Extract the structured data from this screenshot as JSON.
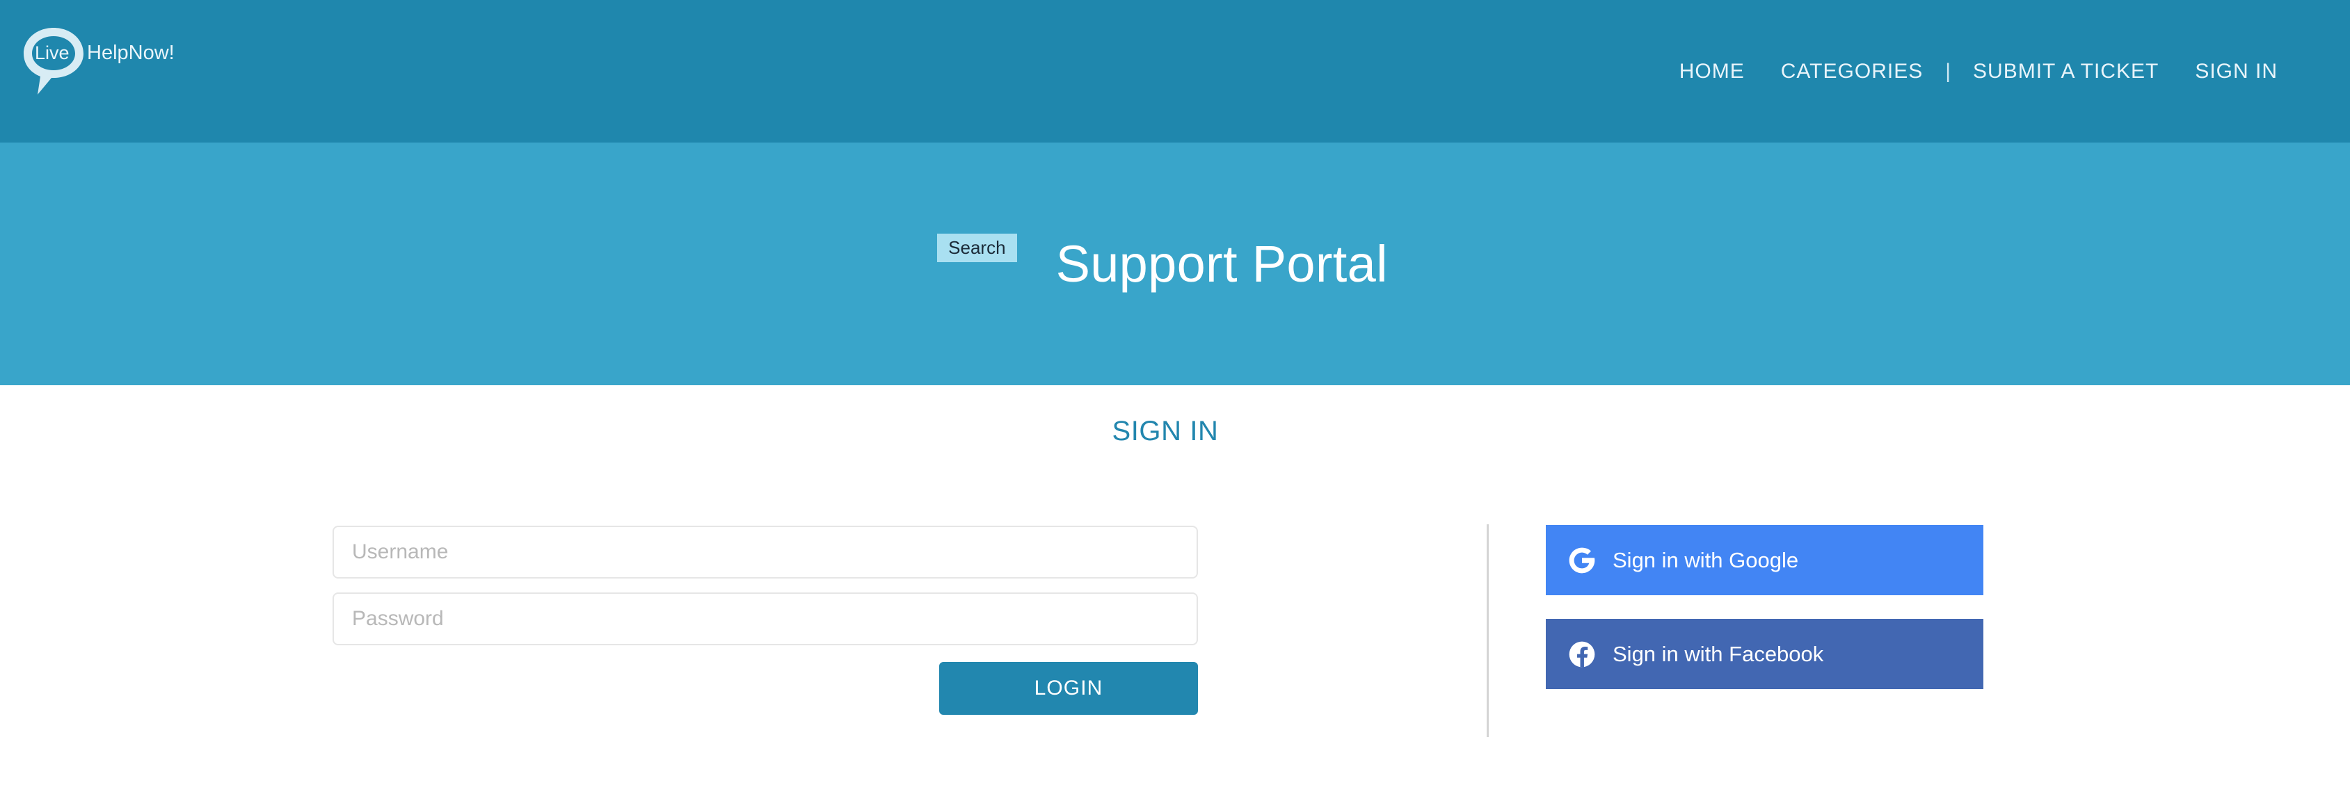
{
  "header": {
    "logo": {
      "name": "livehelpnow-logo",
      "bubble_text": "Live",
      "brand_text": "HelpNow!"
    },
    "nav": [
      {
        "label": "HOME",
        "name": "nav-item-home"
      },
      {
        "label": "CATEGORIES",
        "name": "nav-item-categories"
      },
      {
        "label": "|",
        "name": "nav-separator"
      },
      {
        "label": "SUBMIT A TICKET",
        "name": "nav-item-submit-a-ticket"
      },
      {
        "label": "SIGN IN",
        "name": "nav-item-sign-in"
      }
    ]
  },
  "hero": {
    "search_tag": "Search",
    "title": "Support Portal"
  },
  "main": {
    "heading": "SIGN IN",
    "form": {
      "username_placeholder": "Username",
      "username_value": "",
      "password_placeholder": "Password",
      "password_value": "",
      "login_label": "LOGIN"
    },
    "social": {
      "google_label": "Sign in with Google",
      "facebook_label": "Sign in with Facebook"
    }
  },
  "colors": {
    "header_bg": "#1f87ad",
    "hero_bg": "#39a5ca",
    "accent": "#2287af",
    "heading": "#2286ae",
    "search_tag_bg": "#a9e0f1",
    "google_blue": "#4285f4",
    "facebook_blue": "#4267b2",
    "page_bg": "#ffffff"
  }
}
